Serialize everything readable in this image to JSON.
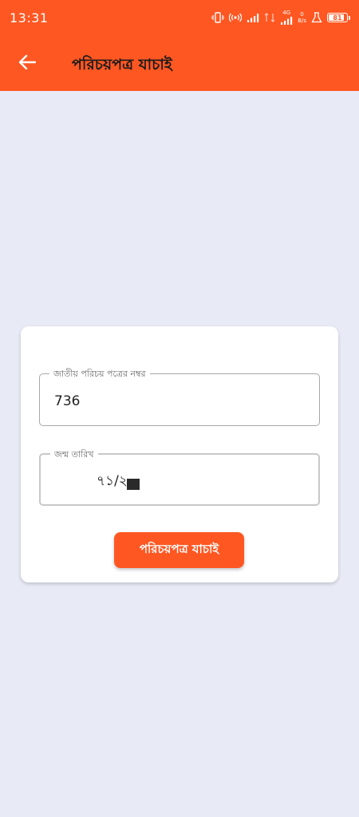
{
  "status_bar": {
    "time": "13:31",
    "network_type": "4G",
    "speed_value": "0",
    "speed_unit": "B/s",
    "battery_level": "81",
    "icons": [
      "vibrate-icon",
      "hotspot-icon",
      "signal-icon",
      "signal-icon",
      "signal-4g-icon",
      "data-speed",
      "lab-icon",
      "battery-icon"
    ]
  },
  "app_bar": {
    "title": "পরিচয়পত্র যাচাই",
    "back_icon": "arrow-left-icon"
  },
  "form": {
    "nid_label": "জাতীয় পরিচয় পত্রের নম্বর",
    "nid_value": "736",
    "dob_label": "জন্ম তারিখ",
    "dob_value": "৭১/২",
    "submit_label": "পরিচয়পত্র যাচাই"
  },
  "colors": {
    "primary": "#ff5722",
    "background": "#e8eaf6",
    "card": "#ffffff"
  }
}
